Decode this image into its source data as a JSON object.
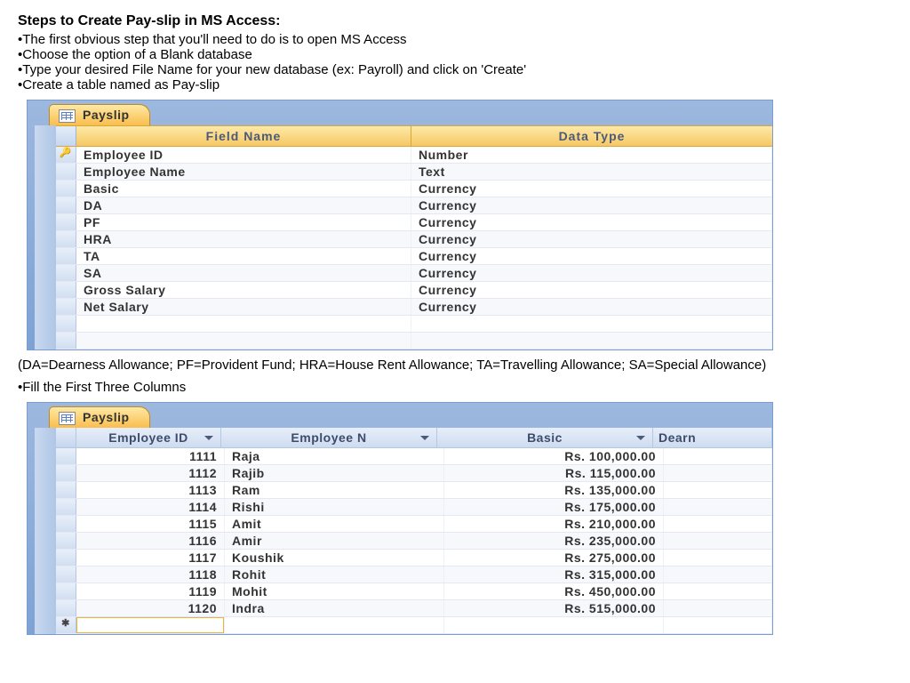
{
  "title": "Steps to Create Pay-slip in MS Access:",
  "bullets": [
    "The first obvious step that you'll need to do is to open MS Access",
    "Choose the option of a Blank database",
    "Type your desired File Name for your new database (ex: Payroll) and click on 'Create'",
    "Create a table named as Pay-slip"
  ],
  "designView": {
    "tabLabel": "Payslip",
    "headers": {
      "fieldName": "Field Name",
      "dataType": "Data Type"
    },
    "rows": [
      {
        "field": "Employee ID",
        "type": "Number",
        "pk": true
      },
      {
        "field": "Employee Name",
        "type": "Text"
      },
      {
        "field": "Basic",
        "type": "Currency"
      },
      {
        "field": "DA",
        "type": "Currency"
      },
      {
        "field": "PF",
        "type": "Currency"
      },
      {
        "field": "HRA",
        "type": "Currency"
      },
      {
        "field": "TA",
        "type": "Currency"
      },
      {
        "field": "SA",
        "type": "Currency"
      },
      {
        "field": "Gross Salary",
        "type": "Currency"
      },
      {
        "field": "Net Salary",
        "type": "Currency"
      }
    ]
  },
  "note": "(DA=Dearness Allowance; PF=Provident Fund; HRA=House Rent Allowance; TA=Travelling Allowance; SA=Special Allowance)",
  "bullet2": "Fill the First Three Columns",
  "dataView": {
    "tabLabel": "Payslip",
    "headers": {
      "id": "Employee ID",
      "name": "Employee N",
      "basic": "Basic",
      "dearn": "Dearn"
    },
    "rows": [
      {
        "id": "1111",
        "name": "Raja",
        "basic": "Rs. 100,000.00"
      },
      {
        "id": "1112",
        "name": "Rajib",
        "basic": "Rs. 115,000.00"
      },
      {
        "id": "1113",
        "name": "Ram",
        "basic": "Rs. 135,000.00"
      },
      {
        "id": "1114",
        "name": "Rishi",
        "basic": "Rs. 175,000.00"
      },
      {
        "id": "1115",
        "name": "Amit",
        "basic": "Rs. 210,000.00"
      },
      {
        "id": "1116",
        "name": "Amir",
        "basic": "Rs. 235,000.00"
      },
      {
        "id": "1117",
        "name": "Koushik",
        "basic": "Rs. 275,000.00"
      },
      {
        "id": "1118",
        "name": "Rohit",
        "basic": "Rs. 315,000.00"
      },
      {
        "id": "1119",
        "name": "Mohit",
        "basic": "Rs. 450,000.00"
      },
      {
        "id": "1120",
        "name": "Indra",
        "basic": "Rs. 515,000.00"
      }
    ]
  }
}
